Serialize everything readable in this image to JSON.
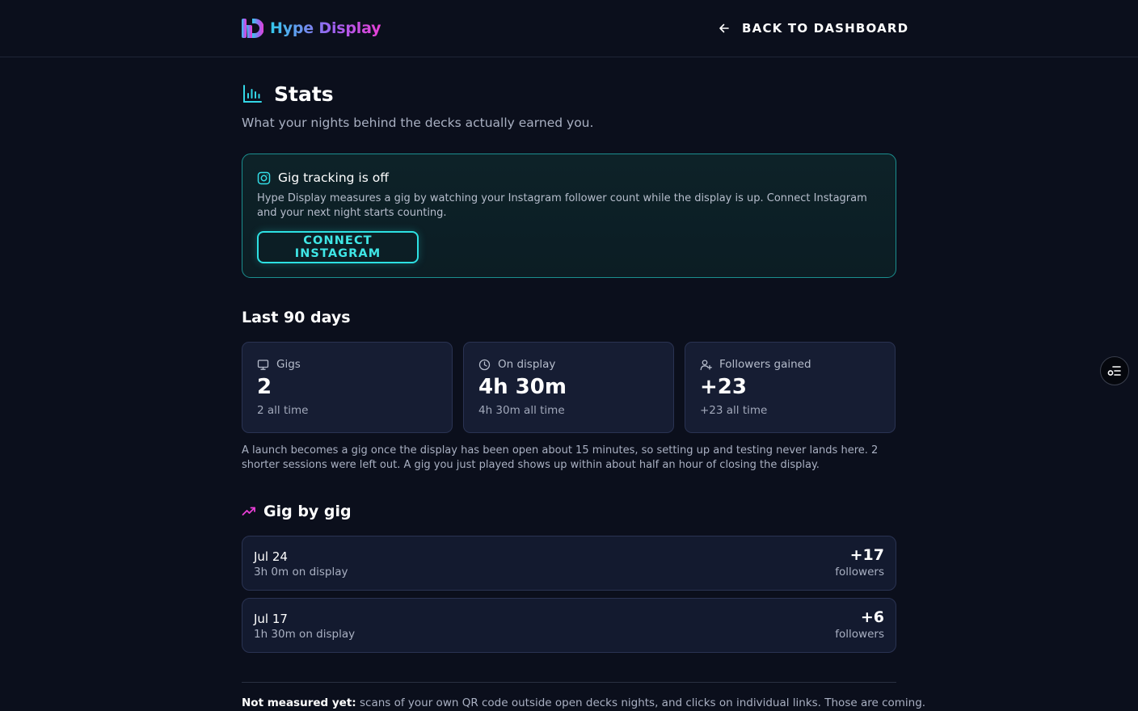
{
  "header": {
    "brand_name": "Hype Display",
    "back_label": "BACK TO DASHBOARD"
  },
  "page": {
    "title": "Stats",
    "subtitle": "What your nights behind the decks actually earned you."
  },
  "tracking_alert": {
    "title": "Gig tracking is off",
    "body": "Hype Display measures a gig by watching your Instagram follower count while the display is up. Connect Instagram and your next night starts counting.",
    "button_label": "CONNECT INSTAGRAM"
  },
  "summary": {
    "heading": "Last 90 days",
    "cards": [
      {
        "icon": "monitor-icon",
        "label": "Gigs",
        "value": "2",
        "sub": "2 all time"
      },
      {
        "icon": "clock-icon",
        "label": "On display",
        "value": "4h 30m",
        "sub": "4h 30m all time"
      },
      {
        "icon": "user-plus-icon",
        "label": "Followers gained",
        "value": "+23",
        "sub": "+23 all time"
      }
    ],
    "note": "A launch becomes a gig once the display has been open about 15 minutes, so setting up and testing never lands here. 2 shorter sessions were left out. A gig you just played shows up within about half an hour of closing the display."
  },
  "gigs": {
    "heading": "Gig by gig",
    "items": [
      {
        "date": "Jul 24",
        "duration": "3h 0m on display",
        "delta": "+17",
        "unit": "followers"
      },
      {
        "date": "Jul 17",
        "duration": "1h 30m on display",
        "delta": "+6",
        "unit": "followers"
      }
    ]
  },
  "footer": {
    "label": "Not measured yet:",
    "text": " scans of your own QR code outside open decks nights, and clicks on individual links. Those are coming."
  },
  "colors": {
    "background": "#0b0f1c",
    "accent_cyan": "#2de1e3",
    "accent_pink": "#e83fd6",
    "card_bg": "#161d33"
  }
}
